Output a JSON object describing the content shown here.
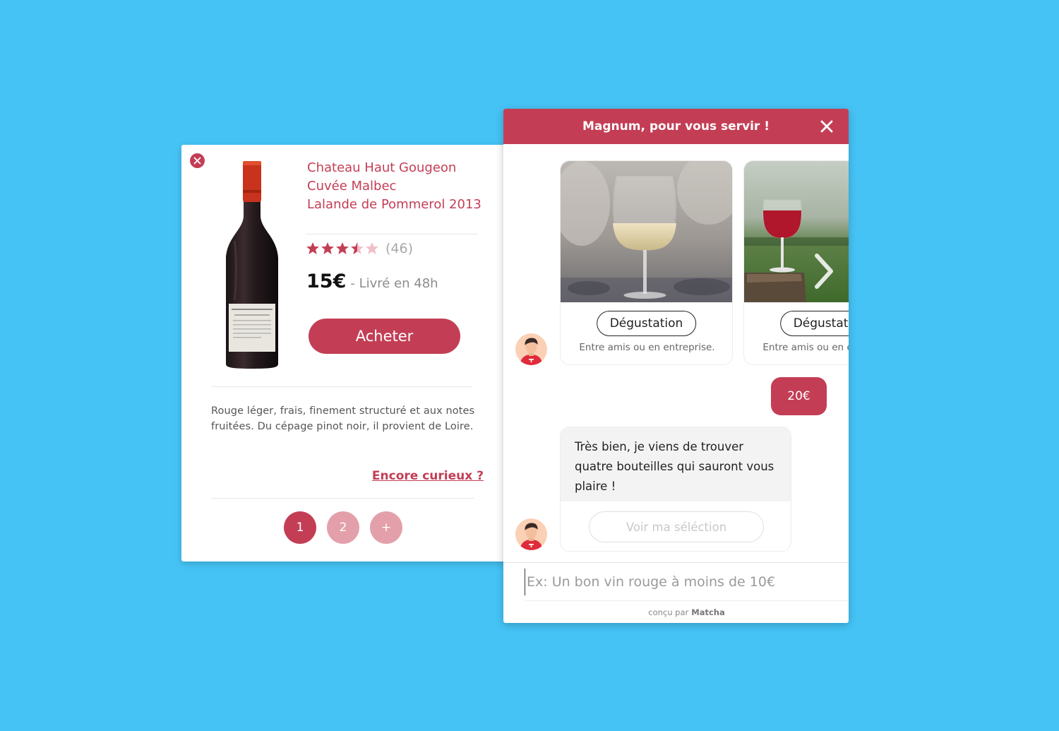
{
  "product": {
    "title_lines": [
      "Chateau Haut Gougeon",
      "Cuvée Malbec",
      "Lalande de Pommerol 2013"
    ],
    "rating": 3.5,
    "rating_max": 5,
    "review_count": "(46)",
    "price": "15€",
    "delivery": "- Livré en 48h",
    "buy_label": "Acheter",
    "description": "Rouge léger, frais, finement structuré et aux notes fruitées. Du cépage pinot noir, il provient de Loire.",
    "more_link": "Encore curieux ?",
    "pages": [
      "1",
      "2",
      "+"
    ],
    "active_page": "1"
  },
  "chat": {
    "header_title": "Magnum, pour vous servir !",
    "cards": [
      {
        "tag": "Dégustation",
        "subtitle": "Entre amis ou en entreprise."
      },
      {
        "tag": "Dégustation",
        "subtitle": "Entre amis ou en entreprise."
      }
    ],
    "user_message": "20€",
    "bot_message": "Très bien, je viens de trouver quatre bouteilles qui sauront vous plaire !",
    "selection_button": "Voir ma séléction",
    "input_placeholder": "Ex: Un bon vin rouge à moins de 10€",
    "footer_prefix": "conçu par",
    "footer_brand": "Matcha"
  },
  "icons": {
    "product_close": "close-icon",
    "chat_close": "close-icon",
    "carousel_next": "chevron-right-icon",
    "bot_avatar": "avatar-icon"
  },
  "colors": {
    "accent": "#c33e55",
    "accent_light": "#e3a0ab",
    "background": "#45c3f5"
  }
}
